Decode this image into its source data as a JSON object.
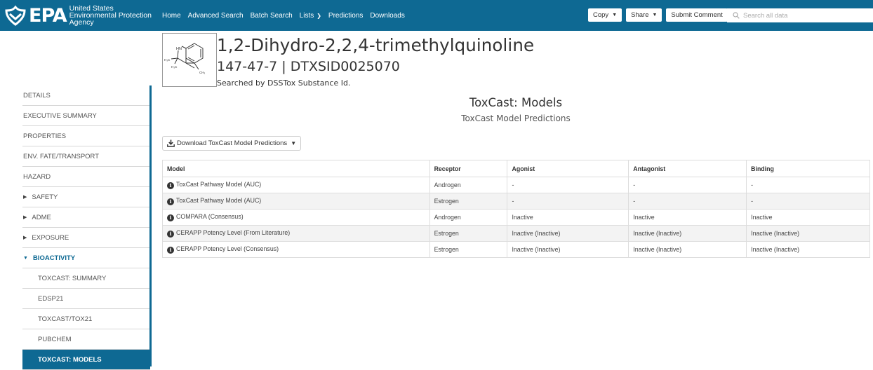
{
  "header": {
    "logo_text": "EPA",
    "agency_line1": "United States",
    "agency_line2": "Environmental Protection",
    "agency_line3": "Agency",
    "nav": [
      {
        "label": "Home"
      },
      {
        "label": "Advanced Search"
      },
      {
        "label": "Batch Search"
      },
      {
        "label": "Lists",
        "caret": "chevron-down-icon"
      },
      {
        "label": "Predictions"
      },
      {
        "label": "Downloads"
      }
    ],
    "copy_label": "Copy",
    "share_label": "Share",
    "submit_label": "Submit Comment",
    "search_placeholder": "Search all data"
  },
  "chemical": {
    "name": "1,2-Dihydro-2,2,4-trimethylquinoline",
    "ids": "147-47-7 | DTXSID0025070",
    "searched_by": "Searched by DSSTox Substance Id.",
    "structure_labels": {
      "nh": "HN",
      "ch3_left": "H₃C",
      "h3c": "H₃C",
      "ch3_right": "CH₃"
    }
  },
  "sidebar": {
    "items": [
      {
        "label": "DETAILS"
      },
      {
        "label": "EXECUTIVE SUMMARY"
      },
      {
        "label": "PROPERTIES"
      },
      {
        "label": "ENV. FATE/TRANSPORT"
      },
      {
        "label": "HAZARD"
      },
      {
        "label": "SAFETY",
        "arrow": "▶"
      },
      {
        "label": "ADME",
        "arrow": "▶"
      },
      {
        "label": "EXPOSURE",
        "arrow": "▶"
      },
      {
        "label": "BIOACTIVITY",
        "arrow": "▼"
      },
      {
        "label": "TOXCAST: SUMMARY"
      },
      {
        "label": "EDSP21"
      },
      {
        "label": "TOXCAST/TOX21"
      },
      {
        "label": "PUBCHEM"
      },
      {
        "label": "TOXCAST: MODELS"
      }
    ]
  },
  "main": {
    "title": "ToxCast: Models",
    "subtitle": "ToxCast Model Predictions",
    "download_label": "Download ToxCast Model Predictions",
    "table": {
      "headers": [
        "Model",
        "Receptor",
        "Agonist",
        "Antagonist",
        "Binding"
      ],
      "rows": [
        [
          "ToxCast Pathway Model (AUC)",
          "Androgen",
          "-",
          "-",
          "-"
        ],
        [
          "ToxCast Pathway Model (AUC)",
          "Estrogen",
          "-",
          "-",
          "-"
        ],
        [
          "COMPARA (Consensus)",
          "Androgen",
          "Inactive",
          "Inactive",
          "Inactive"
        ],
        [
          "CERAPP Potency Level (From Literature)",
          "Estrogen",
          "Inactive (Inactive)",
          "Inactive (Inactive)",
          "Inactive (Inactive)"
        ],
        [
          "CERAPP Potency Level (Consensus)",
          "Estrogen",
          "Inactive (Inactive)",
          "Inactive (Inactive)",
          "Inactive (Inactive)"
        ]
      ]
    }
  },
  "colors": {
    "brand": "#0e6993"
  }
}
